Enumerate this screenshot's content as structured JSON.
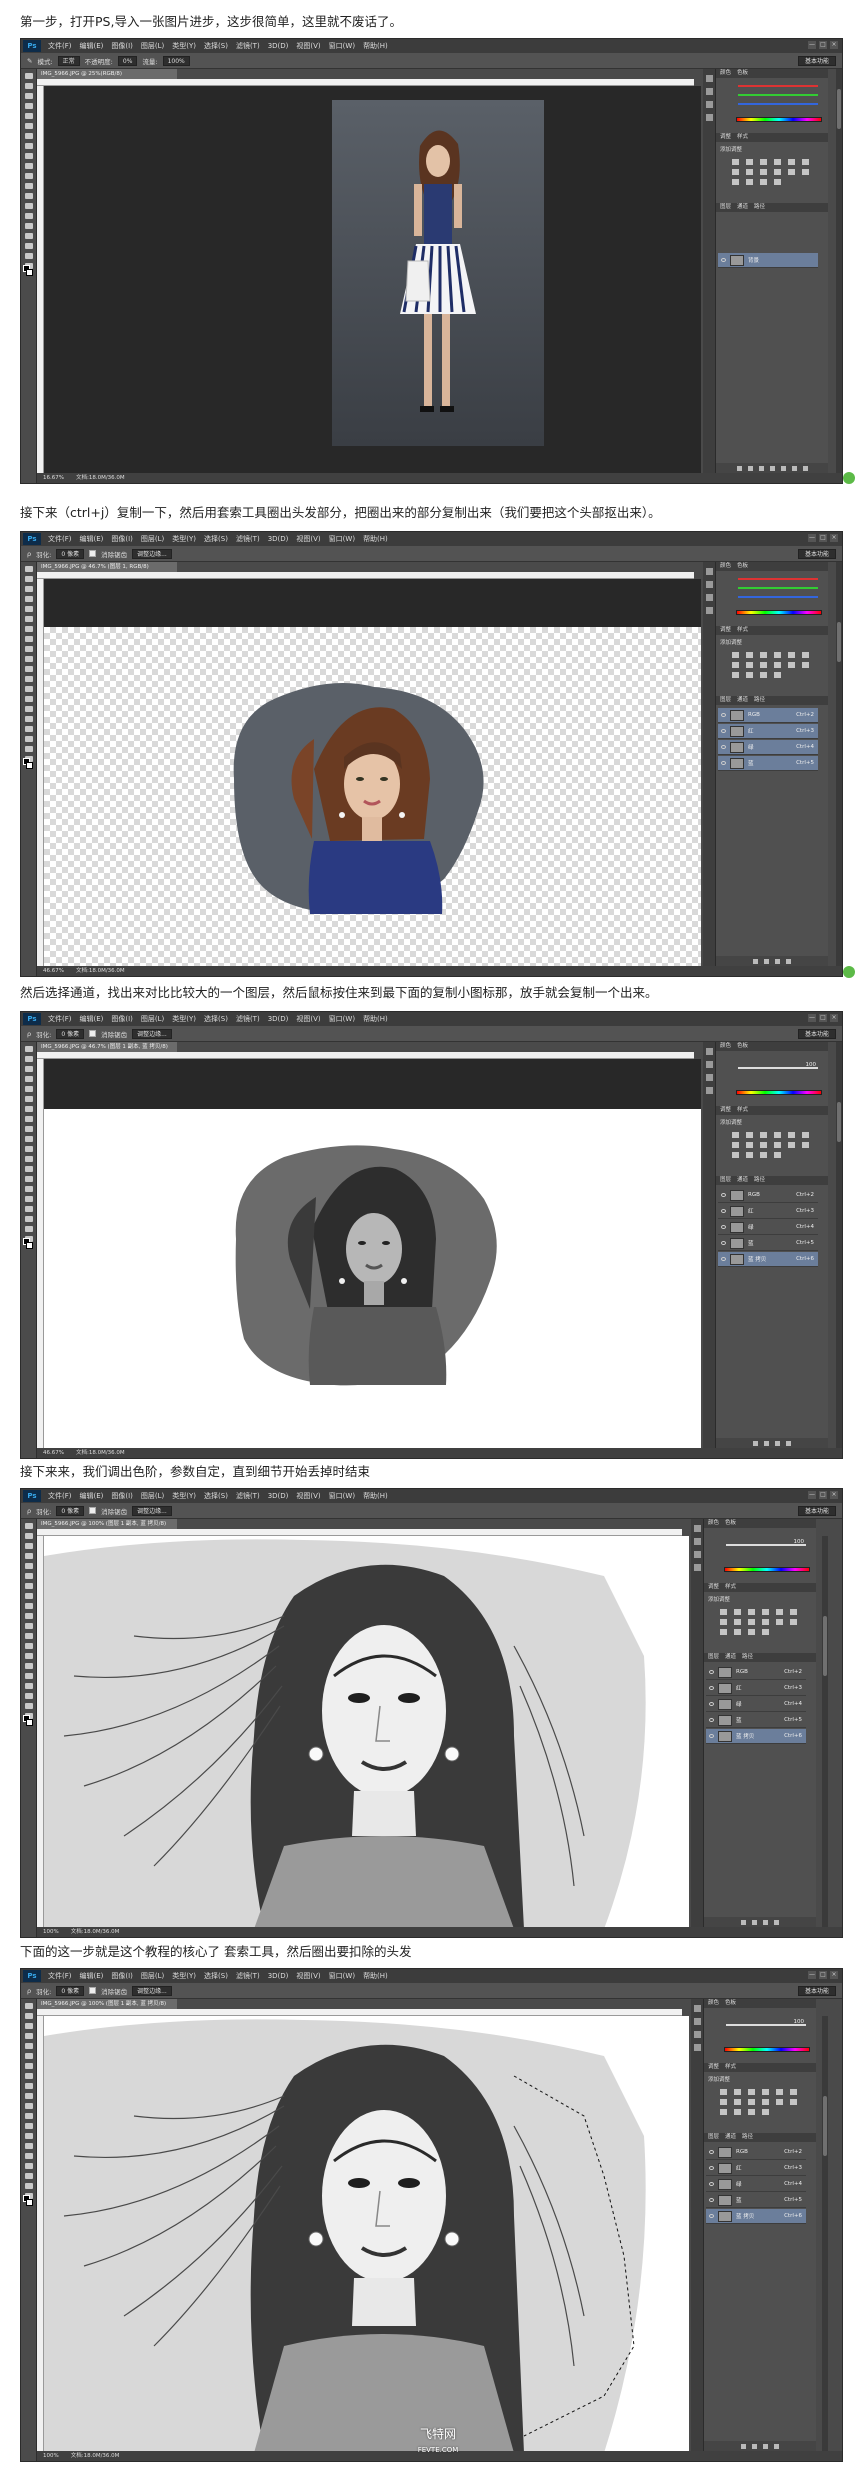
{
  "captions": {
    "step1": "第一步，打开PS,导入一张图片进步，这步很简单，这里就不废话了。",
    "step2": "接下来（ctrl+j）复制一下，然后用套索工具圈出头发部分，把圈出来的部分复制出来（我们要把这个头部抠出来）。",
    "step3": "然后选择通道，找出来对比比较大的一个图层，然后鼠标按住来到最下面的复制小图标那，放手就会复制一个出来。",
    "step4": "接下来来，我们调出色阶，参数自定，直到细节开始丢掉时结束",
    "step5": "下面的这一步就是这个教程的核心了 套索工具，然后圈出要扣除的头发"
  },
  "ps": {
    "logo": "Ps",
    "menu": [
      "文件(F)",
      "编辑(E)",
      "图像(I)",
      "图层(L)",
      "类型(Y)",
      "选择(S)",
      "滤镜(T)",
      "3D(D)",
      "视图(V)",
      "窗口(W)",
      "帮助(H)"
    ],
    "window_controls": [
      "—",
      "□",
      "×"
    ],
    "workspace": "基本功能",
    "feather_label": "羽化:",
    "feather_value": "0 像素",
    "antialias_label": "消除锯齿",
    "refine_edge": "调整边缘...",
    "mode_label": "模式:",
    "mode_value": "正常",
    "opacity_label": "不透明度:",
    "opacity_value": "0%",
    "flow_label": "流量:",
    "flow_value": "100%",
    "doc_tabs": [
      "IMG_5966.JPG @ 25%(RGB/8)",
      "IMG_5966.JPG @ 46.7% (图层 1, RGB/8)",
      "IMG_5966.JPG @ 46.7% (图层 1 副本, 蓝 拷贝/8)",
      "IMG_5966.JPG @ 100% (图层 1 副本, 蓝 拷贝/8)",
      "IMG_5966.JPG @ 100% (图层 1 副本, 蓝 拷贝/8)"
    ],
    "zoom_values": [
      "16.67%",
      "46.67%",
      "46.67%",
      "100%",
      "100%"
    ],
    "doc_size": "文档:18.0M/36.0M",
    "adjust_label": "添加调整",
    "panel_tabs_1": [
      "图层",
      "通道",
      "路径"
    ],
    "panel_tabs_2": [
      "颜色",
      "色板"
    ],
    "panel_tabs_3": [
      "调整",
      "样式"
    ],
    "layers_step1": [
      {
        "name": "背景",
        "sc": ""
      }
    ],
    "channels_step2": [
      {
        "name": "RGB",
        "sc": "Ctrl+2"
      },
      {
        "name": "红",
        "sc": "Ctrl+3"
      },
      {
        "name": "绿",
        "sc": "Ctrl+4"
      },
      {
        "name": "蓝",
        "sc": "Ctrl+5"
      }
    ],
    "channels_copy": [
      {
        "name": "RGB",
        "sc": "Ctrl+2"
      },
      {
        "name": "红",
        "sc": "Ctrl+3"
      },
      {
        "name": "绿",
        "sc": "Ctrl+4"
      },
      {
        "name": "蓝",
        "sc": "Ctrl+5"
      },
      {
        "name": "蓝 拷贝",
        "sc": "Ctrl+6"
      }
    ],
    "k_value": "100"
  },
  "watermark": {
    "line1": "飞特网",
    "line2": "FEVTE.COM"
  },
  "colors": {
    "ps_bg": "#4a4a4a",
    "canvas_bg": "#282828",
    "selected_row": "#6b7e9b",
    "side_tag": "#5cba47"
  }
}
